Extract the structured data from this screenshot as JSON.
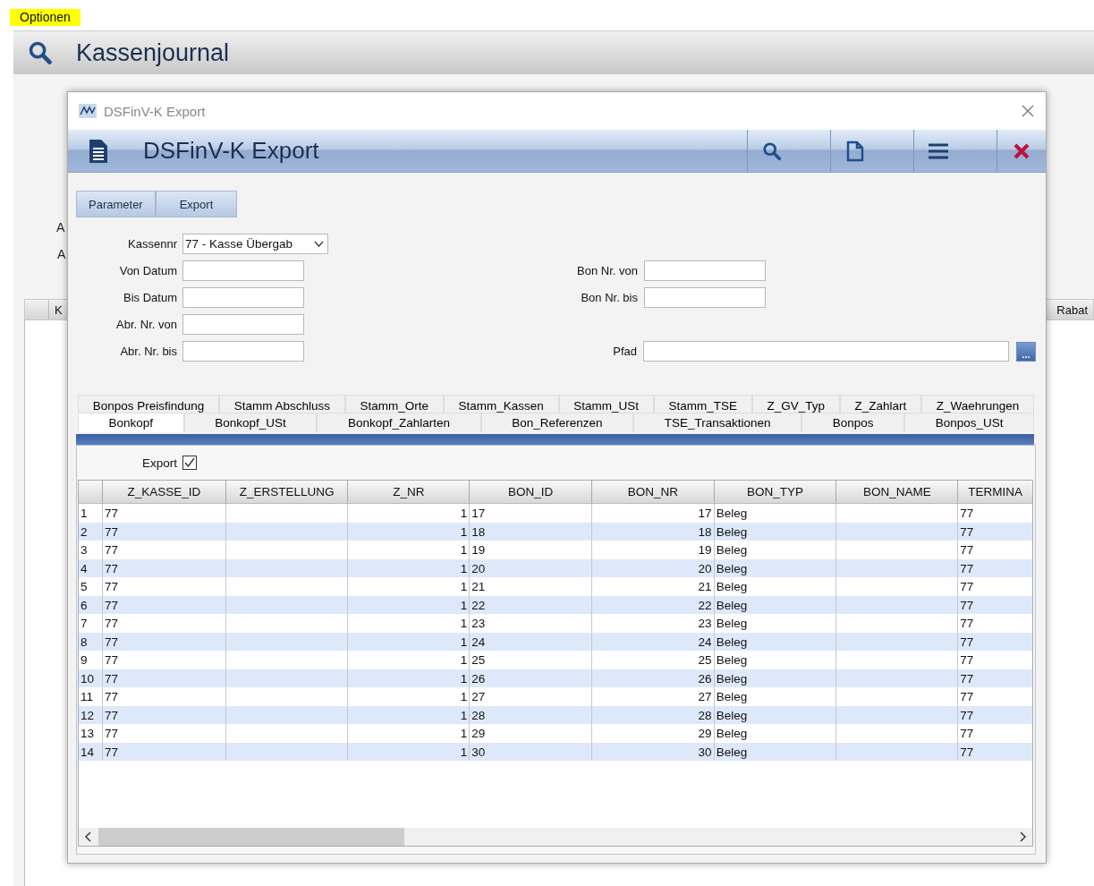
{
  "menu": {
    "label": "Optionen"
  },
  "app": {
    "title": "Kassenjournal",
    "background_labels": [
      "A",
      "A"
    ],
    "background_columns": [
      "K",
      "Rabat"
    ]
  },
  "dialog": {
    "window_title": "DSFinV-K Export",
    "title": "DSFinV-K Export",
    "buttons": [
      {
        "label": "Parameter",
        "selected": false
      },
      {
        "label": "Export",
        "selected": false
      }
    ],
    "form_rows": [
      {
        "left": {
          "label": "Kassennr",
          "kind": "dropdown",
          "value": "77 - Kasse Übergab"
        },
        "right": null
      },
      {
        "left": {
          "label": "Von Datum",
          "kind": "text"
        },
        "right": {
          "label": "Bon Nr. von",
          "kind": "text"
        }
      },
      {
        "left": {
          "label": "Bis Datum",
          "kind": "text"
        },
        "right": {
          "label": "Bon Nr. bis",
          "kind": "text"
        }
      },
      {
        "left": {
          "label": "Abr. Nr. von",
          "kind": "text"
        },
        "right": null
      },
      {
        "left": {
          "label": "Abr. Nr. bis",
          "kind": "text"
        },
        "right": {
          "label": "Pfad",
          "kind": "path",
          "button": "..."
        }
      }
    ],
    "tabs_back": [
      {
        "label": "Bonpos Preisfindung",
        "selected": false
      },
      {
        "label": "Stamm Abschluss",
        "selected": false
      },
      {
        "label": "Stamm_Orte",
        "selected": false
      },
      {
        "label": "Stamm_Kassen",
        "selected": false
      },
      {
        "label": "Stamm_USt",
        "selected": false
      },
      {
        "label": "Stamm_TSE",
        "selected": false
      },
      {
        "label": "Z_GV_Typ",
        "selected": false
      },
      {
        "label": "Z_Zahlart",
        "selected": false
      },
      {
        "label": "Z_Waehrungen",
        "selected": false
      }
    ],
    "tabs_front": [
      {
        "label": "Bonkopf",
        "selected": true
      },
      {
        "label": "Bonkopf_USt",
        "selected": false
      },
      {
        "label": "Bonkopf_Zahlarten",
        "selected": false
      },
      {
        "label": "Bon_Referenzen",
        "selected": false
      },
      {
        "label": "TSE_Transaktionen",
        "selected": false
      },
      {
        "label": "Bonpos",
        "selected": false
      },
      {
        "label": "Bonpos_USt",
        "selected": false
      }
    ],
    "export": {
      "label": "Export",
      "checked": true
    },
    "table": {
      "columns": [
        {
          "label": "Z_KASSE_ID",
          "kind": "text"
        },
        {
          "label": "Z_ERSTELLUNG",
          "kind": "text"
        },
        {
          "label": "Z_NR",
          "kind": "number"
        },
        {
          "label": "BON_ID",
          "kind": "text"
        },
        {
          "label": "BON_NR",
          "kind": "number"
        },
        {
          "label": "BON_TYP",
          "kind": "text"
        },
        {
          "label": "BON_NAME",
          "kind": "text"
        },
        {
          "label": "TERMINA",
          "kind": "text"
        }
      ],
      "rows": [
        {
          "number": "1",
          "cells": [
            "77",
            null,
            "1",
            "17",
            "17",
            "Beleg",
            null,
            "77"
          ]
        },
        {
          "number": "2",
          "cells": [
            "77",
            null,
            "1",
            "18",
            "18",
            "Beleg",
            null,
            "77"
          ]
        },
        {
          "number": "3",
          "cells": [
            "77",
            null,
            "1",
            "19",
            "19",
            "Beleg",
            null,
            "77"
          ]
        },
        {
          "number": "4",
          "cells": [
            "77",
            null,
            "1",
            "20",
            "20",
            "Beleg",
            null,
            "77"
          ]
        },
        {
          "number": "5",
          "cells": [
            "77",
            null,
            "1",
            "21",
            "21",
            "Beleg",
            null,
            "77"
          ]
        },
        {
          "number": "6",
          "cells": [
            "77",
            null,
            "1",
            "22",
            "22",
            "Beleg",
            null,
            "77"
          ]
        },
        {
          "number": "7",
          "cells": [
            "77",
            null,
            "1",
            "23",
            "23",
            "Beleg",
            null,
            "77"
          ]
        },
        {
          "number": "8",
          "cells": [
            "77",
            null,
            "1",
            "24",
            "24",
            "Beleg",
            null,
            "77"
          ]
        },
        {
          "number": "9",
          "cells": [
            "77",
            null,
            "1",
            "25",
            "25",
            "Beleg",
            null,
            "77"
          ]
        },
        {
          "number": "10",
          "cells": [
            "77",
            null,
            "1",
            "26",
            "26",
            "Beleg",
            null,
            "77"
          ]
        },
        {
          "number": "11",
          "cells": [
            "77",
            null,
            "1",
            "27",
            "27",
            "Beleg",
            null,
            "77"
          ]
        },
        {
          "number": "12",
          "cells": [
            "77",
            null,
            "1",
            "28",
            "28",
            "Beleg",
            null,
            "77"
          ]
        },
        {
          "number": "13",
          "cells": [
            "77",
            null,
            "1",
            "29",
            "29",
            "Beleg",
            null,
            "77"
          ]
        },
        {
          "number": "14",
          "cells": [
            "77",
            null,
            "1",
            "30",
            "30",
            "Beleg",
            null,
            "77"
          ]
        }
      ]
    }
  }
}
